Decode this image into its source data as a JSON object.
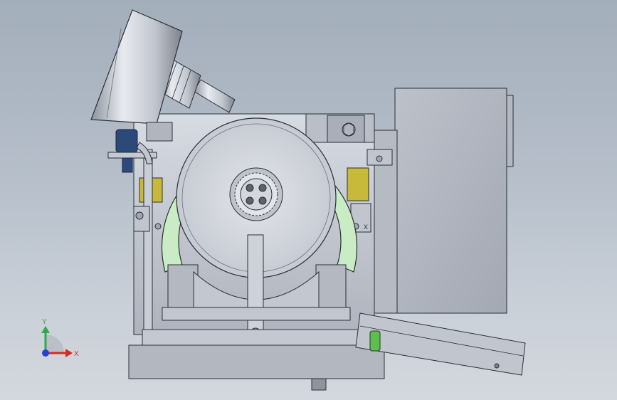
{
  "viewport": {
    "background_top": "#a3aebb",
    "background_bottom": "#d3d8de"
  },
  "colors": {
    "steel": "#c7cbd4",
    "steel_dark": "#9aa0ab",
    "outline": "#2b2f36",
    "wheel_guard": "#c9ecc4",
    "yellow_band": "#c7b93a",
    "knob_blue": "#2b4a7a",
    "pin_green": "#5cc04a"
  },
  "triad": {
    "icon": "coordinate-triad-icon",
    "y_label": "Y",
    "x_label": "X",
    "y_color": "#2fa84f",
    "x_color": "#d32a2a",
    "z_color": "#2a3fd3"
  },
  "model": {
    "name": "grinding-machine-assembly",
    "fixture_label": "X"
  }
}
